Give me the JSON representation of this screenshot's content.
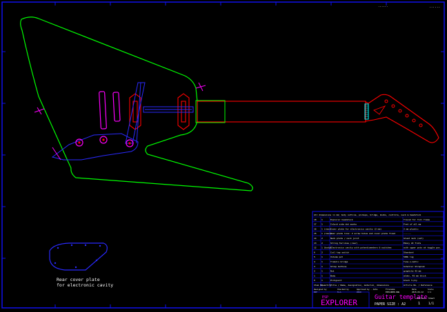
{
  "corner_labels": {
    "top_right_small": "......",
    "top_right_tag": "......"
  },
  "rear_plate_note": [
    "Rear cover plate",
    "for electronic cavity"
  ],
  "title_block": {
    "header_note": "All dimensions in mm; body outline, pickups, bridge, knobs, controls, neck & headstock",
    "rows": [
      {
        "no": "18",
        "qty": "1",
        "desc": "Explorer headstock",
        "note": "Traced for full frame"
      },
      {
        "no": "17",
        "qty": "1",
        "desc": "Inlaid side dot marks",
        "note": "Fret of all ma"
      },
      {
        "no": "16",
        "qty": "1 (rear)",
        "desc": "Cover plate for electronics cavity (2 mm)",
        "note": "2 mm plastic"
      },
      {
        "no": "15",
        "qty": "1 (rear)",
        "desc": "Rear plate line: 2 screw holes and cover plate fixed",
        "note": "------"
      },
      {
        "no": "14",
        "qty": "2",
        "desc": "Neck plate / neck joint",
        "note": "Glued neck (set)"
      },
      {
        "no": "13",
        "qty": "2",
        "desc": "String ferrules (rear)",
        "note": "Ebony 22 frets"
      },
      {
        "no": "12",
        "qty": "1 (body)",
        "desc": "Electronics cavity with potentiometers & switches",
        "note": "with upper pots at toggle pos."
      },
      {
        "no": "6",
        "qty": "2",
        "desc": "Coil tap switch",
        "note": "Standard"
      },
      {
        "no": "5",
        "qty": "1",
        "desc": "Volume pot",
        "note": "500k log"
      },
      {
        "no": "4",
        "qty": "1",
        "desc": "Tremolo bridge",
        "note": "Tune-o-matic"
      },
      {
        "no": "3",
        "qty": "1",
        "desc": "Strap buttons",
        "note": "Schaller Straplok"
      },
      {
        "no": "2",
        "qty": "1",
        "desc": "Nut",
        "note": "graphite 43 mm"
      },
      {
        "no": "1",
        "qty": "1",
        "desc": "Body",
        "note": "alder, 45 mm thick"
      },
      {
        "no": "0",
        "qty": "1",
        "desc": "Pickguard",
        "note": "black 3-ply"
      }
    ],
    "column_headers": [
      "Item No.",
      "Quantity",
      "Title / Name, designation, material, dimensions",
      "Article No. / Reference"
    ],
    "meta_headers": [
      "Designed by",
      "Checked by",
      "Approved by - date",
      "Filename",
      "Date",
      "Scale"
    ],
    "meta_values": [
      "ESP",
      "R.A.",
      "2013",
      "EXPLORER.DWG",
      "2015-04-12",
      "1:1"
    ],
    "brand_small": "ESP",
    "brand": "EXPLORER",
    "title": "Guitar template",
    "paper_size": "PAPER SIZE : A2",
    "edition_label": "Edition",
    "edition_value": "1",
    "sheet_label": "Sheet",
    "sheet_value": "1/1"
  },
  "colors": {
    "body": "#00ff00",
    "neck": "#ff0000",
    "pickups": "#ff00ff",
    "bridge": "#2a2aff",
    "frame": "#1010ee",
    "nut": "#00ffff",
    "text": "#ffffff"
  }
}
